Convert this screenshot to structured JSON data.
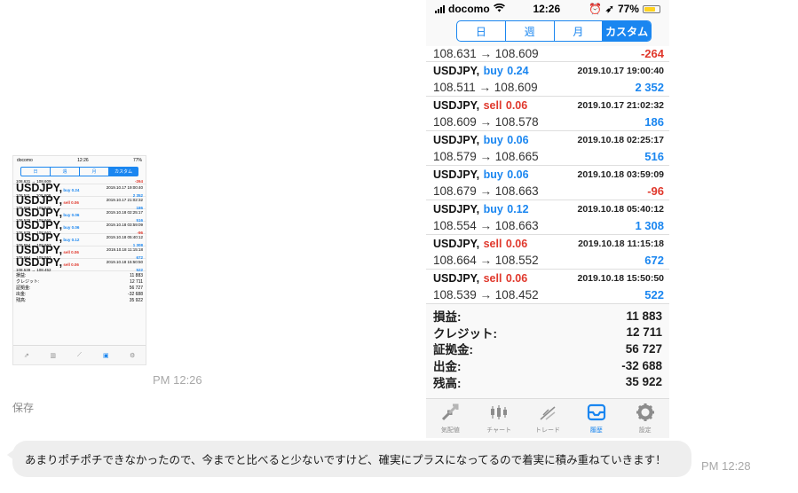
{
  "status_bar": {
    "carrier": "docomo",
    "time": "12:26",
    "battery": "77%"
  },
  "period_tabs": [
    "日",
    "週",
    "月",
    "カスタム"
  ],
  "active_period": "カスタム",
  "first_row": {
    "prices": "108.631 → 108.609",
    "pnl": "-264"
  },
  "trades": [
    {
      "pair": "USDJPY,",
      "side": "buy",
      "lots": "0.24",
      "datetime": "2019.10.17 19:00:40",
      "prices": "108.511 → 108.609",
      "pnl": "2 352"
    },
    {
      "pair": "USDJPY,",
      "side": "sell",
      "lots": "0.06",
      "datetime": "2019.10.17 21:02:32",
      "prices": "108.609 → 108.578",
      "pnl": "186"
    },
    {
      "pair": "USDJPY,",
      "side": "buy",
      "lots": "0.06",
      "datetime": "2019.10.18 02:25:17",
      "prices": "108.579 → 108.665",
      "pnl": "516"
    },
    {
      "pair": "USDJPY,",
      "side": "buy",
      "lots": "0.06",
      "datetime": "2019.10.18 03:59:09",
      "prices": "108.679 → 108.663",
      "pnl": "-96"
    },
    {
      "pair": "USDJPY,",
      "side": "buy",
      "lots": "0.12",
      "datetime": "2019.10.18 05:40:12",
      "prices": "108.554 → 108.663",
      "pnl": "1 308"
    },
    {
      "pair": "USDJPY,",
      "side": "sell",
      "lots": "0.06",
      "datetime": "2019.10.18 11:15:18",
      "prices": "108.664 → 108.552",
      "pnl": "672"
    },
    {
      "pair": "USDJPY,",
      "side": "sell",
      "lots": "0.06",
      "datetime": "2019.10.18 15:50:50",
      "prices": "108.539 → 108.452",
      "pnl": "522"
    }
  ],
  "summary": [
    {
      "label": "損益:",
      "value": "11 883"
    },
    {
      "label": "クレジット:",
      "value": "12 711"
    },
    {
      "label": "証拠金:",
      "value": "56 727"
    },
    {
      "label": "出金:",
      "value": "-32 688"
    },
    {
      "label": "残高:",
      "value": "35 922"
    }
  ],
  "bottom_tabs": [
    {
      "label": "気配値",
      "icon": "quotes-arrows-icon"
    },
    {
      "label": "チャート",
      "icon": "candlestick-chart-icon"
    },
    {
      "label": "トレード",
      "icon": "trade-line-icon"
    },
    {
      "label": "履歴",
      "icon": "history-inbox-icon"
    },
    {
      "label": "設定",
      "icon": "settings-gear-icon"
    }
  ],
  "active_bottom_tab": "履歴",
  "chat": {
    "time_1": "PM 12:26",
    "save_label": "保存",
    "message": "あまりポチポチできなかったので、今までと比べると少ないですけど、確実にプラスになってるので着実に積み重ねていきます！",
    "time_2": "PM 12:28"
  },
  "colors": {
    "accent_blue": "#1a86f0",
    "sell_red": "#e0382c",
    "bubble_bg": "#eeeeee"
  }
}
